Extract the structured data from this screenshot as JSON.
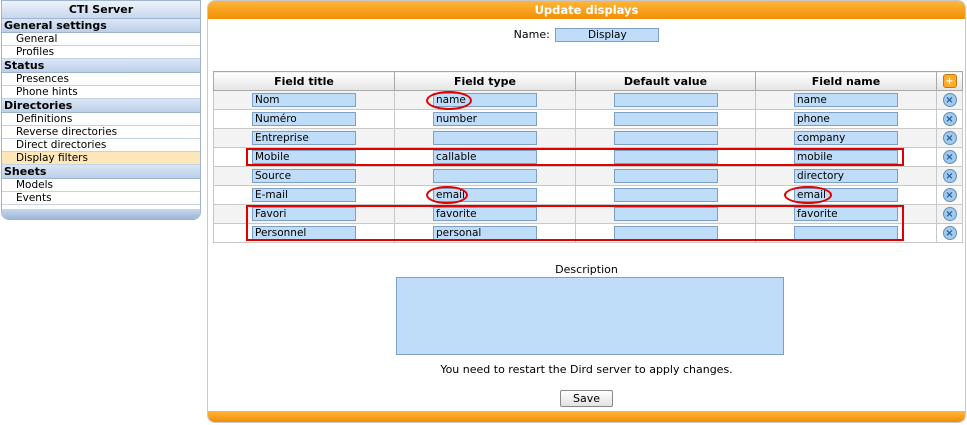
{
  "sidebar": {
    "title": "CTI Server",
    "sections": [
      {
        "label": "General settings",
        "items": [
          {
            "label": "General"
          },
          {
            "label": "Profiles"
          }
        ]
      },
      {
        "label": "Status",
        "items": [
          {
            "label": "Presences"
          },
          {
            "label": "Phone hints"
          }
        ]
      },
      {
        "label": "Directories",
        "items": [
          {
            "label": "Definitions"
          },
          {
            "label": "Reverse directories"
          },
          {
            "label": "Direct directories"
          },
          {
            "label": "Display filters",
            "active": true
          }
        ]
      },
      {
        "label": "Sheets",
        "items": [
          {
            "label": "Models"
          },
          {
            "label": "Events"
          }
        ]
      }
    ]
  },
  "main": {
    "title": "Update displays",
    "name_label": "Name:",
    "name_value": "Display",
    "table": {
      "headers": [
        "Field title",
        "Field type",
        "Default value",
        "Field name"
      ],
      "add_icon": "add-icon",
      "delete_icon": "delete-icon",
      "rows": [
        {
          "title": "Nom",
          "type": "name",
          "default": "",
          "field": "name"
        },
        {
          "title": "Numéro",
          "type": "number",
          "default": "",
          "field": "phone"
        },
        {
          "title": "Entreprise",
          "type": "",
          "default": "",
          "field": "company"
        },
        {
          "title": "Mobile",
          "type": "callable",
          "default": "",
          "field": "mobile"
        },
        {
          "title": "Source",
          "type": "",
          "default": "",
          "field": "directory"
        },
        {
          "title": "E-mail",
          "type": "email",
          "default": "",
          "field": "email"
        },
        {
          "title": "Favori",
          "type": "favorite",
          "default": "",
          "field": "favorite"
        },
        {
          "title": "Personnel",
          "type": "personal",
          "default": "",
          "field": ""
        }
      ]
    },
    "description_label": "Description",
    "description_value": "",
    "restart_note": "You need to restart the Dird server to apply changes.",
    "save_label": "Save"
  },
  "colors": {
    "header_orange": "#f18f05",
    "sidebar_blue": "#bccfe9",
    "input_blue": "#bfdcf8",
    "active_item": "#fde7b8",
    "highlight_red": "#e00000"
  }
}
